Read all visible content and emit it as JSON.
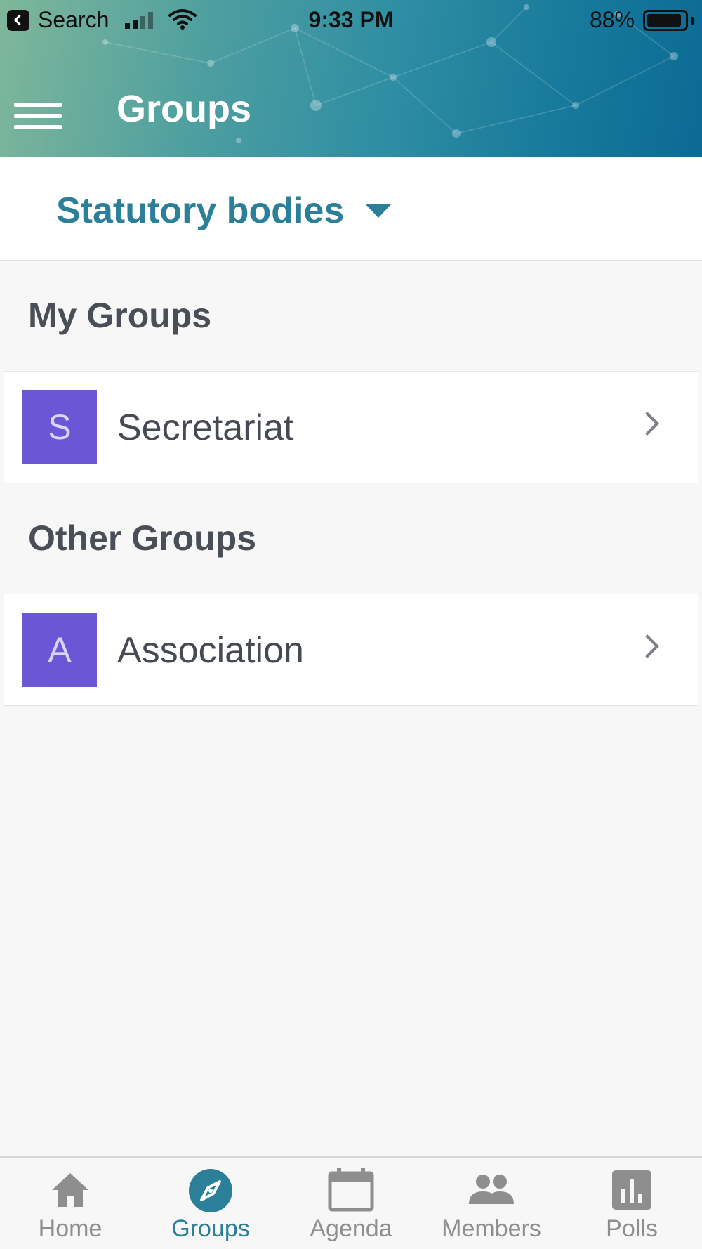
{
  "status_bar": {
    "back_app": "Search",
    "time": "9:33 PM",
    "battery": "88%"
  },
  "header": {
    "title": "Groups",
    "menu_icon": "hamburger-menu-icon"
  },
  "filter": {
    "selected": "Statutory bodies",
    "icon": "caret-down-icon"
  },
  "sections": {
    "my_groups": {
      "title": "My Groups",
      "items": [
        {
          "initial": "S",
          "name": "Secretariat"
        }
      ]
    },
    "other_groups": {
      "title": "Other Groups",
      "items": [
        {
          "initial": "A",
          "name": "Association"
        }
      ]
    }
  },
  "tabbar": {
    "tabs": [
      {
        "label": "Home",
        "icon": "home-icon",
        "active": false
      },
      {
        "label": "Groups",
        "icon": "compass-icon",
        "active": true
      },
      {
        "label": "Agenda",
        "icon": "calendar-icon",
        "active": false
      },
      {
        "label": "Members",
        "icon": "members-icon",
        "active": false
      },
      {
        "label": "Polls",
        "icon": "poll-chart-icon",
        "active": false
      }
    ]
  },
  "colors": {
    "accent": "#2b7f99",
    "avatar": "#6b57d6",
    "tab_inactive": "#8e8e8e"
  }
}
